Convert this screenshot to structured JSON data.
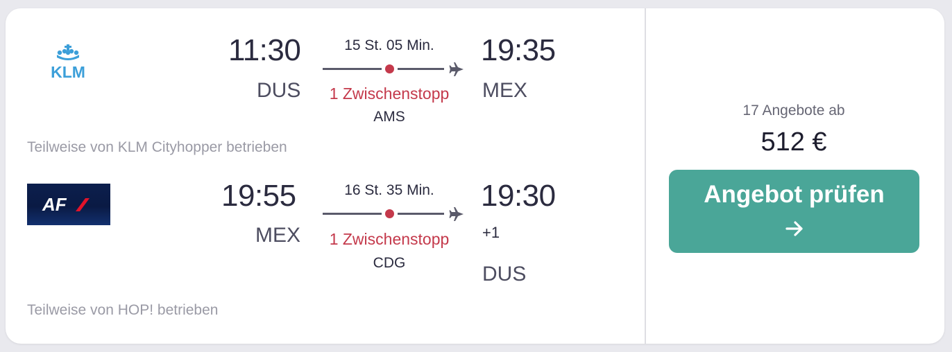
{
  "colors": {
    "stop_red": "#c4394b",
    "cta_teal": "#4aa698",
    "klm_blue": "#3c9fd9",
    "af_navy": "#0c1f4d",
    "af_red": "#e2132a"
  },
  "outbound": {
    "airline_logo": "KLM",
    "depart_time": "11:30",
    "depart_code": "DUS",
    "duration": "15 St. 05 Min.",
    "stops": "1 Zwischenstopp",
    "via": "AMS",
    "arrive_time": "19:35",
    "arrive_code": "MEX",
    "operated_by": "Teilweise von KLM Cityhopper betrieben"
  },
  "return": {
    "airline_logo": "AF",
    "depart_time": "19:55",
    "depart_code": "MEX",
    "duration": "16 St. 35 Min.",
    "stops": "1 Zwischenstopp",
    "via": "CDG",
    "arrive_time": "19:30",
    "arrive_day_offset": "+1",
    "arrive_code": "DUS",
    "operated_by": "Teilweise von HOP! betrieben"
  },
  "offer": {
    "count_label": "17 Angebote ab",
    "price": "512 €",
    "button_label": "Angebot prüfen",
    "button_icon": "arrow-right-icon"
  }
}
